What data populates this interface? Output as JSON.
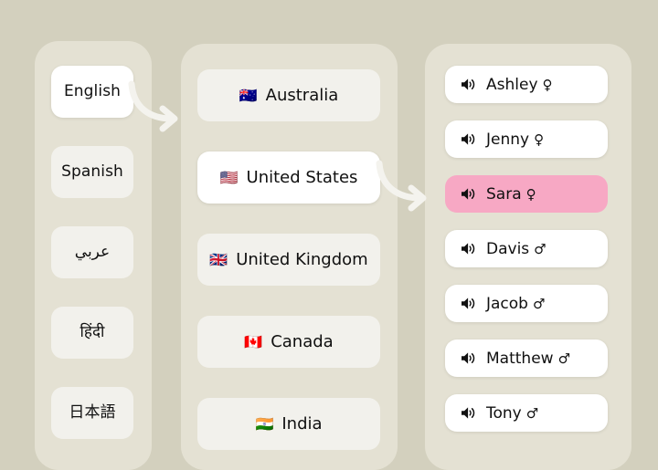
{
  "theme": {
    "page_background": "#d3d0be",
    "panel_background": "#e4e1d3",
    "card_background": "#f2f1ec",
    "card_selected_background": "#ffffff",
    "card_selected_accent": "#f7a8c4",
    "text_color": "#101010"
  },
  "languages": {
    "panel_name": "language-column",
    "items": [
      {
        "label": "English",
        "selected": true
      },
      {
        "label": "Spanish",
        "selected": false
      },
      {
        "label": "عربي",
        "selected": false
      },
      {
        "label": "हिंदी",
        "selected": false
      },
      {
        "label": "日本語",
        "selected": false
      }
    ]
  },
  "countries": {
    "panel_name": "country-column",
    "items": [
      {
        "flag": "🇦🇺",
        "label": "Australia",
        "selected": false
      },
      {
        "flag": "🇺🇸",
        "label": "United States",
        "selected": true
      },
      {
        "flag": "🇬🇧",
        "label": "United Kingdom",
        "selected": false
      },
      {
        "flag": "🇨🇦",
        "label": "Canada",
        "selected": false
      },
      {
        "flag": "🇮🇳",
        "label": "India",
        "selected": false
      }
    ]
  },
  "voices": {
    "panel_name": "voice-column",
    "icon": "speaker-icon",
    "items": [
      {
        "name": "Ashley",
        "gender": "♀",
        "selected": false
      },
      {
        "name": "Jenny",
        "gender": "♀",
        "selected": false
      },
      {
        "name": "Sara",
        "gender": "♀",
        "selected": true
      },
      {
        "name": "Davis",
        "gender": "♂",
        "selected": false
      },
      {
        "name": "Jacob",
        "gender": "♂",
        "selected": false
      },
      {
        "name": "Matthew",
        "gender": "♂",
        "selected": false
      },
      {
        "name": "Tony",
        "gender": "♂",
        "selected": false
      }
    ]
  },
  "connectors": [
    {
      "name": "arrow-language-to-country",
      "color": "#f4f3ee"
    },
    {
      "name": "arrow-country-to-voice",
      "color": "#f4f3ee"
    }
  ]
}
